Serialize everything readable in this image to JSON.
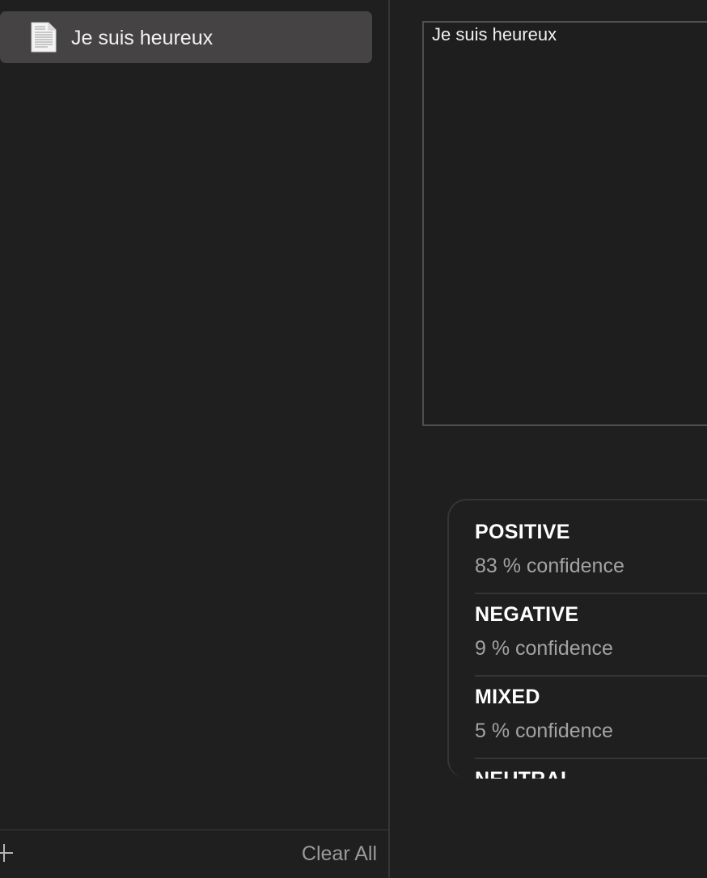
{
  "sidebar": {
    "items": [
      {
        "label": "Je suis heureux",
        "icon": "document-icon",
        "selected": true
      }
    ],
    "footer": {
      "add_icon": "plus-icon",
      "clear_all_label": "Clear All"
    }
  },
  "editor": {
    "text": "Je suis heureux"
  },
  "results": [
    {
      "label": "POSITIVE",
      "confidence": "83 % confidence"
    },
    {
      "label": "NEGATIVE",
      "confidence": "9 % confidence"
    },
    {
      "label": "MIXED",
      "confidence": "5 % confidence"
    },
    {
      "label": "NEUTRAL",
      "confidence": ""
    }
  ],
  "colors": {
    "background": "#1f1f1f",
    "selected_item": "#464344",
    "secondary_text": "#a3a3a3"
  }
}
